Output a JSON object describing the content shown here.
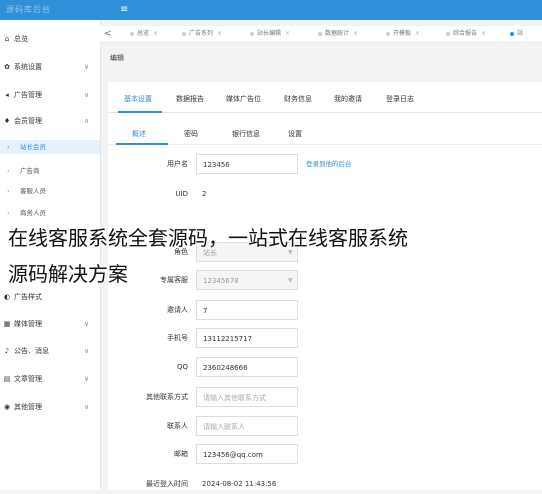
{
  "header": {
    "logo_text": "源码库后台",
    "menu_icon": "menu-icon"
  },
  "sidebar": {
    "items": [
      {
        "id": "home",
        "icon": "home-icon",
        "glyph": "⌂",
        "label": "总览",
        "chevron": ""
      },
      {
        "id": "settings",
        "icon": "gear-icon",
        "glyph": "✿",
        "label": "系统设置",
        "chevron": "∨"
      },
      {
        "id": "ads",
        "icon": "megaphone-icon",
        "glyph": "◂",
        "label": "广告管理",
        "chevron": "∨"
      },
      {
        "id": "members",
        "icon": "user-icon",
        "glyph": "♦",
        "label": "会员管理",
        "chevron": "∧"
      }
    ],
    "sub_items": [
      "站长会员",
      "广告商",
      "客服人员",
      "商务人员"
    ],
    "lower_items": [
      {
        "id": "ad-style",
        "icon": "ad-icon",
        "glyph": "◐",
        "label": "广告样式",
        "chevron": ""
      },
      {
        "id": "media",
        "icon": "media-icon",
        "glyph": "▦",
        "label": "媒体管理",
        "chevron": "∨"
      },
      {
        "id": "notice",
        "icon": "bell-icon",
        "glyph": "♪",
        "label": "公告、消息",
        "chevron": "∨"
      },
      {
        "id": "article",
        "icon": "article-icon",
        "glyph": "▤",
        "label": "文章管理",
        "chevron": "∨"
      },
      {
        "id": "other",
        "icon": "other-icon",
        "glyph": "◉",
        "label": "其他管理",
        "chevron": "∨"
      }
    ]
  },
  "tabs": {
    "back_glyph": "<",
    "items": [
      "总览",
      "广告系列",
      "站长编辑",
      "数据统计",
      "开模板",
      "综合报告",
      "站"
    ]
  },
  "breadcrumb": "编辑",
  "main_tabs": [
    "基本设置",
    "数据报告",
    "媒体广告位",
    "财务信息",
    "我的邀请",
    "登录日志"
  ],
  "sub_tabs": [
    "概述",
    "密码",
    "银行信息",
    "设置"
  ],
  "form": {
    "username_label": "用户名",
    "username_value": "123456",
    "login_link": "登录到他的后台",
    "uid_label": "UID",
    "uid_value": "2",
    "role_label": "角色",
    "role_value": "站长",
    "service_label": "专属客服",
    "service_value": "12345678",
    "inviter_label": "邀请人",
    "inviter_value": "7",
    "phone_label": "手机号",
    "phone_value": "13112215717",
    "qq_label": "QQ",
    "qq_value": "2360248666",
    "other_contact_label": "其他联系方式",
    "other_contact_placeholder": "请输入其他联系方式",
    "contact_label": "联系人",
    "contact_placeholder": "请输入联系人",
    "email_label": "邮箱",
    "email_value": "123456@qq.com",
    "last_login_label": "最近登入时间",
    "last_login_value": "2024-08-02 11:43:56"
  },
  "overlay": {
    "line1": "在线客服系统全套源码，一站式在线客服系统",
    "line2": "源码解决方案"
  },
  "colors": {
    "brand": "#2f8fd8",
    "active_bg": "#e6f1fb"
  }
}
